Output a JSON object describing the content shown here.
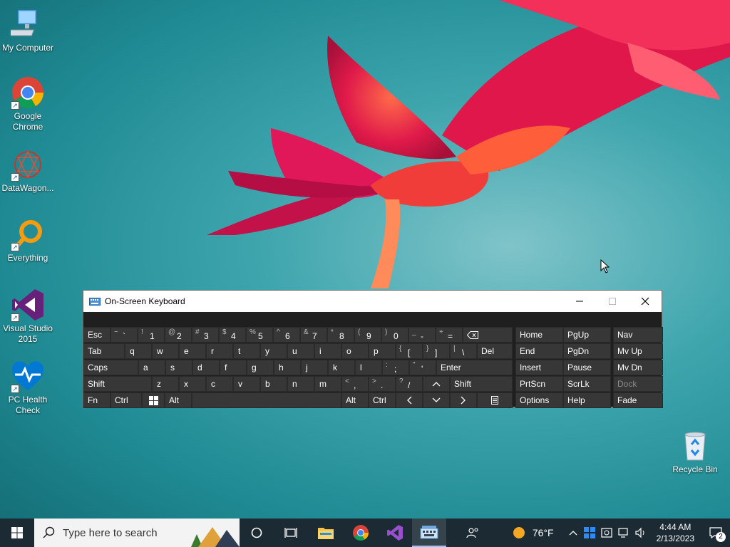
{
  "desktop": {
    "icons": [
      {
        "label": "My Computer"
      },
      {
        "label": "Google Chrome"
      },
      {
        "label": "DataWagon..."
      },
      {
        "label": "Everything"
      },
      {
        "label": "Visual Studio 2015"
      },
      {
        "label": "PC Health Check"
      },
      {
        "label": "Recycle Bin"
      }
    ]
  },
  "osk": {
    "title": "On-Screen Keyboard",
    "row1": [
      {
        "shift": "~",
        "main": "`"
      },
      {
        "shift": "!",
        "main": "1"
      },
      {
        "shift": "@",
        "main": "2"
      },
      {
        "shift": "#",
        "main": "3"
      },
      {
        "shift": "$",
        "main": "4"
      },
      {
        "shift": "%",
        "main": "5"
      },
      {
        "shift": "^",
        "main": "6"
      },
      {
        "shift": "&",
        "main": "7"
      },
      {
        "shift": "*",
        "main": "8"
      },
      {
        "shift": "(",
        "main": "9"
      },
      {
        "shift": ")",
        "main": "0"
      },
      {
        "shift": "_",
        "main": "-"
      },
      {
        "shift": "+",
        "main": "="
      }
    ],
    "esc": "Esc",
    "tab": "Tab",
    "caps": "Caps",
    "shift_l": "Shift",
    "shift_r": "Shift",
    "fn": "Fn",
    "ctrl_l": "Ctrl",
    "alt_l": "Alt",
    "alt_r": "Alt",
    "ctrl_r": "Ctrl",
    "del": "Del",
    "enter": "Enter",
    "row2": [
      "q",
      "w",
      "e",
      "r",
      "t",
      "y",
      "u",
      "i",
      "o",
      "p"
    ],
    "row2_br1": {
      "shift": "{",
      "main": "["
    },
    "row2_br2": {
      "shift": "}",
      "main": "]"
    },
    "row2_bs": {
      "shift": "|",
      "main": "\\"
    },
    "row3": [
      "a",
      "s",
      "d",
      "f",
      "g",
      "h",
      "j",
      "k",
      "l"
    ],
    "row3_sc": {
      "shift": ":",
      "main": ";"
    },
    "row3_q": {
      "shift": "\"",
      "main": "'"
    },
    "row4": [
      "z",
      "x",
      "c",
      "v",
      "b",
      "n",
      "m"
    ],
    "row4_lt": {
      "shift": "<",
      "main": ","
    },
    "row4_gt": {
      "shift": ">",
      "main": "."
    },
    "row4_sl": {
      "shift": "?",
      "main": "/"
    },
    "nav": {
      "home": "Home",
      "pgup": "PgUp",
      "nav": "Nav",
      "end": "End",
      "pgdn": "PgDn",
      "mvup": "Mv Up",
      "insert": "Insert",
      "pause": "Pause",
      "mvdn": "Mv Dn",
      "prtscn": "PrtScn",
      "scrlk": "ScrLk",
      "dock": "Dock",
      "options": "Options",
      "help": "Help",
      "fade": "Fade"
    }
  },
  "taskbar": {
    "search_placeholder": "Type here to search",
    "weather": "76°F",
    "time": "4:44 AM",
    "date": "2/13/2023",
    "notifications": "2"
  }
}
